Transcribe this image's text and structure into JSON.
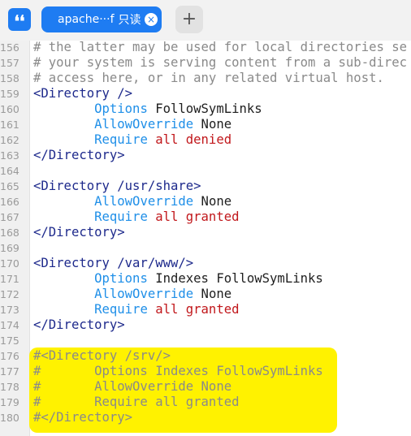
{
  "tab": {
    "title": "apache···f",
    "badge": "只读",
    "close_glyph": "×"
  },
  "add_tab_glyph": "+",
  "lines": [
    {
      "n": "156",
      "segs": [
        {
          "t": "# the latter may be used for local directories se",
          "c": "comment"
        }
      ]
    },
    {
      "n": "157",
      "segs": [
        {
          "t": "# your system is serving content from a sub-direc",
          "c": "comment"
        }
      ]
    },
    {
      "n": "158",
      "segs": [
        {
          "t": "# access here, or in any related virtual host.",
          "c": "comment"
        }
      ]
    },
    {
      "n": "159",
      "segs": [
        {
          "t": "<Directory />",
          "c": "tag"
        }
      ]
    },
    {
      "n": "160",
      "segs": [
        {
          "t": "        ",
          "c": "val"
        },
        {
          "t": "Options",
          "c": "key"
        },
        {
          "t": " FollowSymLinks",
          "c": "val"
        }
      ]
    },
    {
      "n": "161",
      "segs": [
        {
          "t": "        ",
          "c": "val"
        },
        {
          "t": "AllowOverride",
          "c": "key"
        },
        {
          "t": " None",
          "c": "val"
        }
      ]
    },
    {
      "n": "162",
      "segs": [
        {
          "t": "        ",
          "c": "val"
        },
        {
          "t": "Require",
          "c": "key"
        },
        {
          "t": " all denied",
          "c": "red"
        }
      ]
    },
    {
      "n": "163",
      "segs": [
        {
          "t": "</Directory>",
          "c": "tag"
        }
      ]
    },
    {
      "n": "164",
      "segs": []
    },
    {
      "n": "165",
      "segs": [
        {
          "t": "<Directory /usr/share>",
          "c": "tag"
        }
      ]
    },
    {
      "n": "166",
      "segs": [
        {
          "t": "        ",
          "c": "val"
        },
        {
          "t": "AllowOverride",
          "c": "key"
        },
        {
          "t": " None",
          "c": "val"
        }
      ]
    },
    {
      "n": "167",
      "segs": [
        {
          "t": "        ",
          "c": "val"
        },
        {
          "t": "Require",
          "c": "key"
        },
        {
          "t": " all granted",
          "c": "red"
        }
      ]
    },
    {
      "n": "168",
      "segs": [
        {
          "t": "</Directory>",
          "c": "tag"
        }
      ]
    },
    {
      "n": "169",
      "segs": []
    },
    {
      "n": "170",
      "segs": [
        {
          "t": "<Directory /var/www/>",
          "c": "tag"
        }
      ]
    },
    {
      "n": "171",
      "segs": [
        {
          "t": "        ",
          "c": "val"
        },
        {
          "t": "Options",
          "c": "key"
        },
        {
          "t": " Indexes FollowSymLinks",
          "c": "val"
        }
      ]
    },
    {
      "n": "172",
      "segs": [
        {
          "t": "        ",
          "c": "val"
        },
        {
          "t": "AllowOverride",
          "c": "key"
        },
        {
          "t": " None",
          "c": "val"
        }
      ]
    },
    {
      "n": "173",
      "segs": [
        {
          "t": "        ",
          "c": "val"
        },
        {
          "t": "Require",
          "c": "key"
        },
        {
          "t": " all granted",
          "c": "red"
        }
      ]
    },
    {
      "n": "174",
      "segs": [
        {
          "t": "</Directory>",
          "c": "tag"
        }
      ]
    },
    {
      "n": "175",
      "segs": []
    },
    {
      "n": "176",
      "segs": [
        {
          "t": "#<Directory /srv/>",
          "c": "comment"
        }
      ]
    },
    {
      "n": "177",
      "segs": [
        {
          "t": "#       Options Indexes FollowSymLinks",
          "c": "comment"
        }
      ]
    },
    {
      "n": "178",
      "segs": [
        {
          "t": "#       AllowOverride None",
          "c": "comment"
        }
      ]
    },
    {
      "n": "179",
      "segs": [
        {
          "t": "#       Require all granted",
          "c": "comment"
        }
      ]
    },
    {
      "n": "180",
      "segs": [
        {
          "t": "#</Directory>",
          "c": "comment"
        }
      ]
    }
  ],
  "colors": {
    "accent": "#1e7cf2",
    "comment": "#8a8a8a",
    "tag": "#1e2a8c",
    "keyword": "#1f8fe8",
    "value_red": "#c1171b",
    "highlight": "#fff200"
  }
}
